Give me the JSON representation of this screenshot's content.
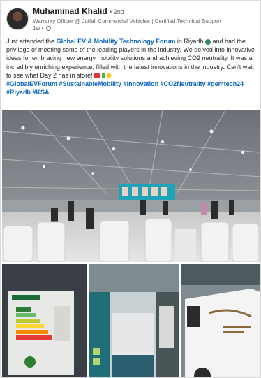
{
  "author": {
    "name": "Muhammad Khalid",
    "degree": "• 2nd",
    "headline": "Warranty Officer @ Juffali Commercial Vehicles | Certified Technical Support",
    "time": "1w •"
  },
  "post": {
    "p1": "Just attended the ",
    "event_link": "Global EV & Mobility Technology Forum",
    "p2": " in Riyadh ",
    "p3": " and had the privilege of meeting some of the leading players in the industry. We delved into innovative ideas for embracing new energy mobility solutions and achieving CO2 neutrality. It was an incredibly enriching experience, filled with the latest innovations in the industry. Can't wait to see what Day 2 has in store! ",
    "hashtags": [
      "#GlobalEVForum",
      "#SustainableMobility",
      "#Innovation",
      "#CO2Neutrality",
      "#gemtech24",
      "#Riyadh",
      "#KSA"
    ]
  },
  "icons": {
    "avatar": "profile-photo",
    "visibility": "globe-icon",
    "emojis": [
      "earth-globe-emoji",
      "car-emoji",
      "battery-emoji",
      "sparkles-emoji"
    ]
  },
  "photos": [
    {
      "name": "forum-hall-photo"
    },
    {
      "name": "energy-label-photo"
    },
    {
      "name": "exhibition-booth-photo"
    },
    {
      "name": "white-van-photo"
    }
  ],
  "colors": {
    "link": "#0a66c2",
    "text": "#2a2a2a",
    "muted": "#666666"
  }
}
